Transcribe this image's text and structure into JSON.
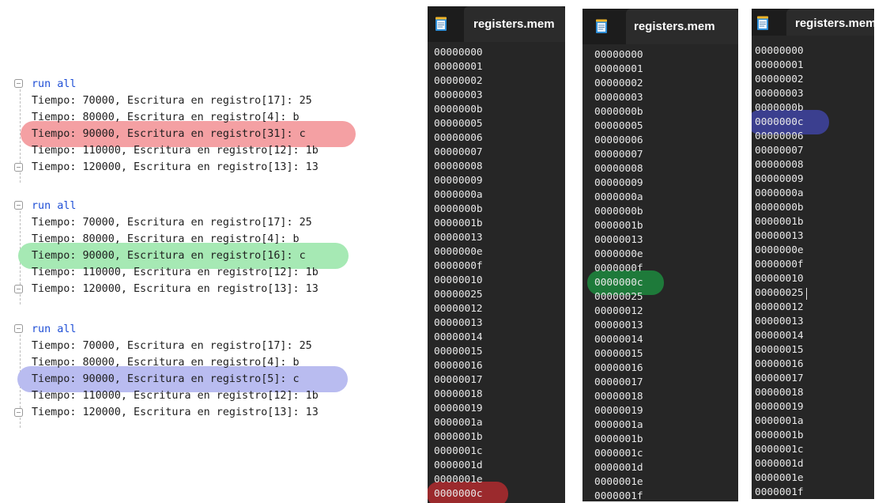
{
  "console": {
    "blocks": [
      {
        "command": "run all",
        "lines": [
          "Tiempo: 70000, Escritura en registro[17]: 25",
          "Tiempo: 80000, Escritura en registro[4]: b",
          "Tiempo: 90000, Escritura en registro[31]: c",
          "Tiempo: 110000, Escritura en registro[12]: 1b",
          "Tiempo: 120000, Escritura en registro[13]: 13"
        ],
        "highlight_line": 2,
        "highlight_color": "#f4a0a3"
      },
      {
        "command": "run all",
        "lines": [
          "Tiempo: 70000, Escritura en registro[17]: 25",
          "Tiempo: 80000, Escritura en registro[4]: b",
          "Tiempo: 90000, Escritura en registro[16]: c",
          "Tiempo: 110000, Escritura en registro[12]: 1b",
          "Tiempo: 120000, Escritura en registro[13]: 13"
        ],
        "highlight_line": 2,
        "highlight_color": "#a6e9b4"
      },
      {
        "command": "run all",
        "lines": [
          "Tiempo: 70000, Escritura en registro[17]: 25",
          "Tiempo: 80000, Escritura en registro[4]: b",
          "Tiempo: 90000, Escritura en registro[5]: c",
          "Tiempo: 110000, Escritura en registro[12]: 1b",
          "Tiempo: 120000, Escritura en registro[13]: 13"
        ],
        "highlight_line": 2,
        "highlight_color": "#b9bcf0"
      }
    ]
  },
  "editors": [
    {
      "tab_label": "registers.mem",
      "icon": "notepad-icon",
      "lines": [
        "00000000",
        "00000001",
        "00000002",
        "00000003",
        "0000000b",
        "00000005",
        "00000006",
        "00000007",
        "00000008",
        "00000009",
        "0000000a",
        "0000000b",
        "0000001b",
        "00000013",
        "0000000e",
        "0000000f",
        "00000010",
        "00000025",
        "00000012",
        "00000013",
        "00000014",
        "00000015",
        "00000016",
        "00000017",
        "00000018",
        "00000019",
        "0000001a",
        "0000001b",
        "0000001c",
        "0000001d",
        "0000001e",
        "0000000c"
      ],
      "highlight_line": 31,
      "highlight_color": "#9b2a2d"
    },
    {
      "tab_label": "registers.mem",
      "icon": "notepad-icon",
      "lines": [
        "00000000",
        "00000001",
        "00000002",
        "00000003",
        "0000000b",
        "00000005",
        "00000006",
        "00000007",
        "00000008",
        "00000009",
        "0000000a",
        "0000000b",
        "0000001b",
        "00000013",
        "0000000e",
        "0000000f",
        "0000000c",
        "00000025",
        "00000012",
        "00000013",
        "00000014",
        "00000015",
        "00000016",
        "00000017",
        "00000018",
        "00000019",
        "0000001a",
        "0000001b",
        "0000001c",
        "0000001d",
        "0000001e",
        "0000001f"
      ],
      "highlight_line": 16,
      "highlight_color": "#1e7a3a"
    },
    {
      "tab_label": "registers.mem",
      "icon": "notepad-icon",
      "lines": [
        "00000000",
        "00000001",
        "00000002",
        "00000003",
        "0000000b",
        "0000000c",
        "00000006",
        "00000007",
        "00000008",
        "00000009",
        "0000000a",
        "0000000b",
        "0000001b",
        "00000013",
        "0000000e",
        "0000000f",
        "00000010",
        "00000025",
        "00000012",
        "00000013",
        "00000014",
        "00000015",
        "00000016",
        "00000017",
        "00000018",
        "00000019",
        "0000001a",
        "0000001b",
        "0000001c",
        "0000001d",
        "0000001e",
        "0000001f"
      ],
      "highlight_line": 5,
      "highlight_color": "#3b3f8f",
      "caret_line": 17
    }
  ]
}
